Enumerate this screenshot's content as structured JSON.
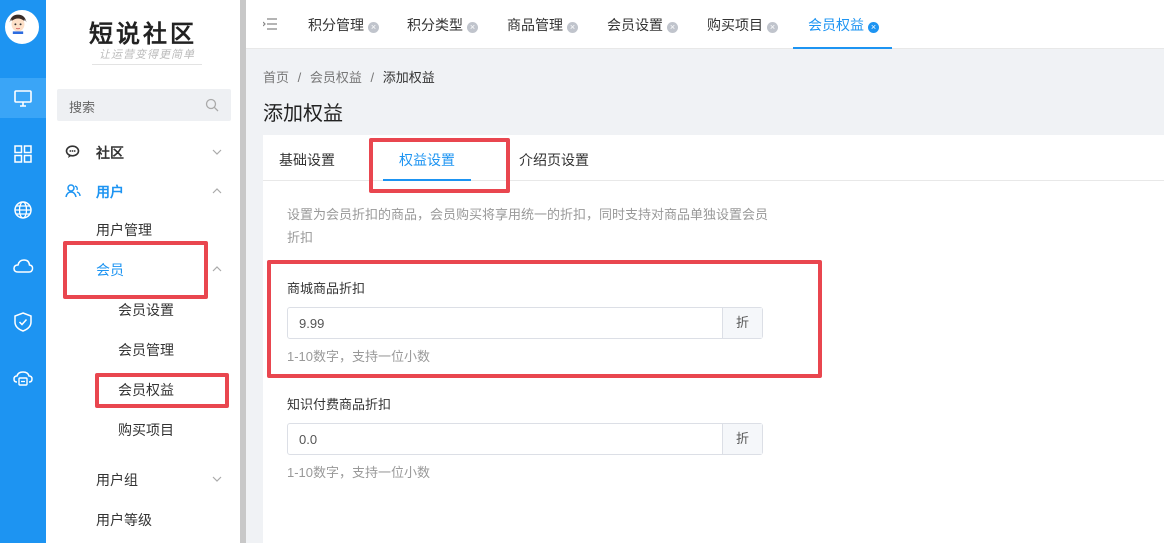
{
  "brand": {
    "title": "短说社区",
    "subtitle": "让运营变得更简单"
  },
  "rail": {
    "icons": [
      "monitor-icon",
      "grid-icon",
      "globe-icon",
      "cloud-icon",
      "shield-check-icon",
      "cloud-settings-icon"
    ],
    "accent": "#1d94f2"
  },
  "sidebar": {
    "search_placeholder": "搜索",
    "items": [
      {
        "label": "社区"
      },
      {
        "label": "用户"
      },
      {
        "label": "用户管理"
      },
      {
        "label": "会员"
      },
      {
        "label": "会员设置"
      },
      {
        "label": "会员管理"
      },
      {
        "label": "会员权益"
      },
      {
        "label": "购买项目"
      },
      {
        "label": "用户组"
      },
      {
        "label": "用户等级"
      }
    ]
  },
  "top_tabs": [
    {
      "label": "积分管理"
    },
    {
      "label": "积分类型"
    },
    {
      "label": "商品管理"
    },
    {
      "label": "会员设置"
    },
    {
      "label": "购买项目"
    },
    {
      "label": "会员权益",
      "active": true
    }
  ],
  "breadcrumb": {
    "home": "首页",
    "sep": "/",
    "level1": "会员权益",
    "current": "添加权益"
  },
  "page_title": "添加权益",
  "content_tabs": [
    {
      "label": "基础设置"
    },
    {
      "label": "权益设置",
      "active": true
    },
    {
      "label": "介绍页设置"
    }
  ],
  "description": "设置为会员折扣的商品，会员购买将享用统一的折扣，同时支持对商品单独设置会员折扣",
  "fields": {
    "mall": {
      "label": "商城商品折扣",
      "value": "9.99",
      "unit": "折",
      "hint": "1-10数字，支持一位小数"
    },
    "knowledge": {
      "label": "知识付费商品折扣",
      "value": "0.0",
      "unit": "折",
      "hint": "1-10数字，支持一位小数"
    }
  },
  "colors": {
    "highlight": "#e9464f",
    "primary": "#1d94f2"
  }
}
